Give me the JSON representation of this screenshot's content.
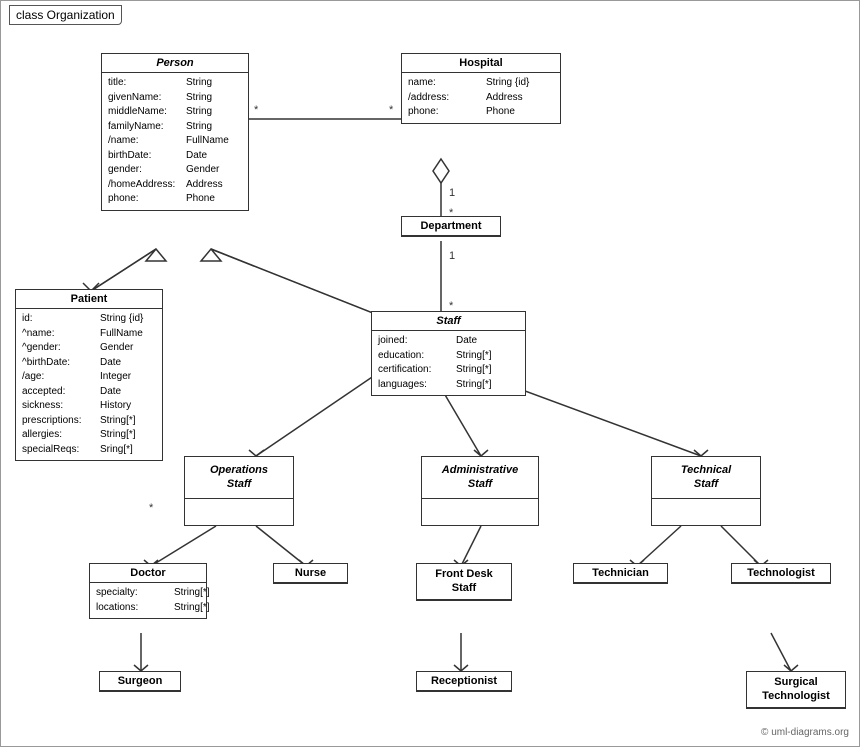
{
  "diagram": {
    "title": "class Organization",
    "copyright": "© uml-diagrams.org",
    "classes": {
      "person": {
        "name": "Person",
        "italic": true,
        "attrs": [
          {
            "name": "title:",
            "type": "String"
          },
          {
            "name": "givenName:",
            "type": "String"
          },
          {
            "name": "middleName:",
            "type": "String"
          },
          {
            "name": "familyName:",
            "type": "String"
          },
          {
            "name": "/name:",
            "type": "FullName"
          },
          {
            "name": "birthDate:",
            "type": "Date"
          },
          {
            "name": "gender:",
            "type": "Gender"
          },
          {
            "name": "/homeAddress:",
            "type": "Address"
          },
          {
            "name": "phone:",
            "type": "Phone"
          }
        ]
      },
      "hospital": {
        "name": "Hospital",
        "italic": false,
        "attrs": [
          {
            "name": "name:",
            "type": "String {id}"
          },
          {
            "name": "/address:",
            "type": "Address"
          },
          {
            "name": "phone:",
            "type": "Phone"
          }
        ]
      },
      "department": {
        "name": "Department",
        "italic": false,
        "attrs": []
      },
      "staff": {
        "name": "Staff",
        "italic": true,
        "attrs": [
          {
            "name": "joined:",
            "type": "Date"
          },
          {
            "name": "education:",
            "type": "String[*]"
          },
          {
            "name": "certification:",
            "type": "String[*]"
          },
          {
            "name": "languages:",
            "type": "String[*]"
          }
        ]
      },
      "patient": {
        "name": "Patient",
        "italic": false,
        "attrs": [
          {
            "name": "id:",
            "type": "String {id}"
          },
          {
            "name": "^name:",
            "type": "FullName"
          },
          {
            "name": "^gender:",
            "type": "Gender"
          },
          {
            "name": "^birthDate:",
            "type": "Date"
          },
          {
            "name": "/age:",
            "type": "Integer"
          },
          {
            "name": "accepted:",
            "type": "Date"
          },
          {
            "name": "sickness:",
            "type": "History"
          },
          {
            "name": "prescriptions:",
            "type": "String[*]"
          },
          {
            "name": "allergies:",
            "type": "String[*]"
          },
          {
            "name": "specialReqs:",
            "type": "Sring[*]"
          }
        ]
      },
      "operations_staff": {
        "name": "Operations\nStaff",
        "italic": true,
        "attrs": []
      },
      "administrative_staff": {
        "name": "Administrative\nStaff",
        "italic": true,
        "attrs": []
      },
      "technical_staff": {
        "name": "Technical\nStaff",
        "italic": true,
        "attrs": []
      },
      "doctor": {
        "name": "Doctor",
        "italic": false,
        "attrs": [
          {
            "name": "specialty:",
            "type": "String[*]"
          },
          {
            "name": "locations:",
            "type": "String[*]"
          }
        ]
      },
      "nurse": {
        "name": "Nurse",
        "italic": false,
        "attrs": []
      },
      "front_desk_staff": {
        "name": "Front Desk\nStaff",
        "italic": false,
        "attrs": []
      },
      "technician": {
        "name": "Technician",
        "italic": false,
        "attrs": []
      },
      "technologist": {
        "name": "Technologist",
        "italic": false,
        "attrs": []
      },
      "surgeon": {
        "name": "Surgeon",
        "italic": false,
        "attrs": []
      },
      "receptionist": {
        "name": "Receptionist",
        "italic": false,
        "attrs": []
      },
      "surgical_technologist": {
        "name": "Surgical\nTechnologist",
        "italic": false,
        "attrs": []
      }
    }
  }
}
